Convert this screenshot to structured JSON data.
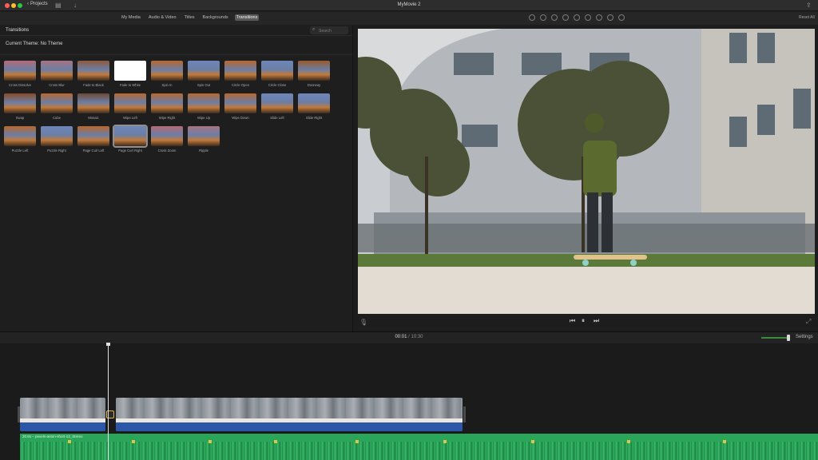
{
  "window": {
    "title": "MyMovie 2",
    "back_label": "Projects",
    "traffic_colors": [
      "#fe5f57",
      "#febc2e",
      "#28c840"
    ]
  },
  "tabs": [
    {
      "label": "My Media",
      "active": false
    },
    {
      "label": "Audio & Video",
      "active": false
    },
    {
      "label": "Titles",
      "active": false
    },
    {
      "label": "Backgrounds",
      "active": false
    },
    {
      "label": "Transitions",
      "active": true
    }
  ],
  "viewer_header": {
    "reset_label": "Reset All"
  },
  "browser": {
    "title": "Transitions",
    "search_placeholder": "Search",
    "theme_label": "Current Theme: No Theme",
    "transitions": [
      {
        "label": "Cross Dissolve",
        "tone": "#b46a78"
      },
      {
        "label": "Cross Blur",
        "tone": "#a87482"
      },
      {
        "label": "Fade to Black",
        "tone": "#8e5a3c"
      },
      {
        "label": "Fade to White",
        "tone": "#ffffff"
      },
      {
        "label": "Spin In",
        "tone": "#b9672d"
      },
      {
        "label": "Spin Out",
        "tone": "#6e87b8"
      },
      {
        "label": "Circle Open",
        "tone": "#b9672d"
      },
      {
        "label": "Circle Close",
        "tone": "#6e87b8"
      },
      {
        "label": "Doorway",
        "tone": "#9a5a2a"
      },
      {
        "label": "Swap",
        "tone": "#8a4a24"
      },
      {
        "label": "Cube",
        "tone": "#b9672d"
      },
      {
        "label": "Mosaic",
        "tone": "#6f4a36"
      },
      {
        "label": "Wipe Left",
        "tone": "#b9672d"
      },
      {
        "label": "Wipe Right",
        "tone": "#b9672d"
      },
      {
        "label": "Wipe Up",
        "tone": "#b9672d"
      },
      {
        "label": "Wipe Down",
        "tone": "#b9672d"
      },
      {
        "label": "Slide Left",
        "tone": "#6e87b8"
      },
      {
        "label": "Slide Right",
        "tone": "#6e87b8"
      },
      {
        "label": "Puzzle Left",
        "tone": "#b9672d"
      },
      {
        "label": "Puzzle Right",
        "tone": "#6e87b8"
      },
      {
        "label": "Page Curl Left",
        "tone": "#b9672d"
      },
      {
        "label": "Page Curl Right",
        "tone": "#6e87b8",
        "selected": true
      },
      {
        "label": "Cross Zoom",
        "tone": "#b46a78"
      },
      {
        "label": "Ripple",
        "tone": "#a87482"
      }
    ]
  },
  "timeline": {
    "timecode_current": "00:01",
    "timecode_total": "10:30",
    "settings_label": "Settings",
    "audio_clip_label": "20.6s – pexels-anton-short-13_Stereo"
  },
  "playback": {
    "skip_back_icon": "skip-back-icon",
    "play_pause_icon": "pause-icon",
    "skip_forward_icon": "skip-forward-icon"
  }
}
